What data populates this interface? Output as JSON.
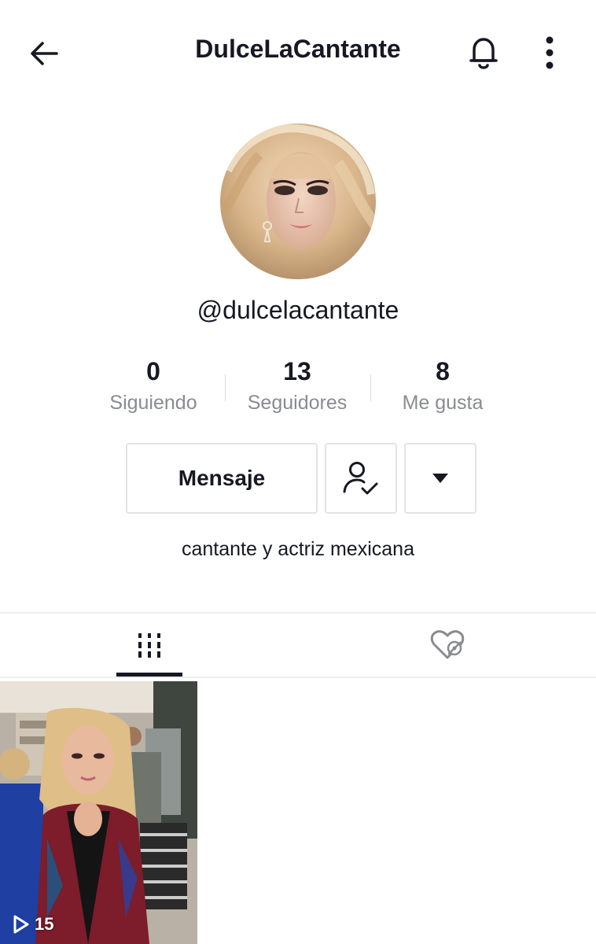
{
  "header": {
    "title": "DulceLaCantante"
  },
  "profile": {
    "username": "@dulcelacantante",
    "bio": "cantante y actriz mexicana"
  },
  "stats": [
    {
      "value": "0",
      "label": "Siguiendo"
    },
    {
      "value": "13",
      "label": "Seguidores"
    },
    {
      "value": "8",
      "label": "Me gusta"
    }
  ],
  "actions": {
    "message_label": "Mensaje"
  },
  "tabs": [
    {
      "icon": "grid-icon",
      "active": true
    },
    {
      "icon": "liked-hidden-icon",
      "active": false
    }
  ],
  "videos": [
    {
      "views": "15"
    }
  ],
  "colors": {
    "text_primary": "#161823",
    "text_secondary": "#8a8b91",
    "border": "#e3e3e4"
  }
}
